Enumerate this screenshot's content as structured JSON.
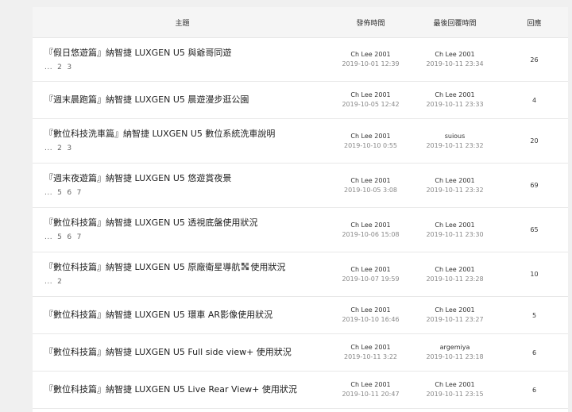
{
  "header": {
    "topic": "主題",
    "published": "發佈時間",
    "last_reply": "最後回覆時間",
    "replies": "回應"
  },
  "rows": [
    {
      "title": "『假日悠遊篇』納智捷 LUXGEN U5 與爺哥同遊",
      "pages": [
        "...",
        "2",
        "3"
      ],
      "pub_user": "Ch Lee 2001",
      "pub_time": "2019-10-01 12:39",
      "last_user": "Ch Lee 2001",
      "last_time": "2019-10-11 23:34",
      "replies": "26"
    },
    {
      "title": "『週末晨跑篇』納智捷 LUXGEN U5 晨遊漫步逛公園",
      "pages": [],
      "pub_user": "Ch Lee 2001",
      "pub_time": "2019-10-05 12:42",
      "last_user": "Ch Lee 2001",
      "last_time": "2019-10-11 23:33",
      "replies": "4"
    },
    {
      "title": "『數位科技洗車篇』納智捷 LUXGEN U5 數位系統洗車說明",
      "pages": [
        "...",
        "2",
        "3"
      ],
      "pub_user": "Ch Lee 2001",
      "pub_time": "2019-10-10 0:55",
      "last_user": "suious",
      "last_time": "2019-10-11 23:32",
      "replies": "20"
    },
    {
      "title": "『週末夜遊篇』納智捷 LUXGEN U5 悠遊賞夜景",
      "pages": [
        "...",
        "5",
        "6",
        "7"
      ],
      "pub_user": "Ch Lee 2001",
      "pub_time": "2019-10-05 3:08",
      "last_user": "Ch Lee 2001",
      "last_time": "2019-10-11 23:32",
      "replies": "69"
    },
    {
      "title": "『數位科技篇』納智捷 LUXGEN U5 透視底盤使用狀況",
      "pages": [
        "...",
        "5",
        "6",
        "7"
      ],
      "pub_user": "Ch Lee 2001",
      "pub_time": "2019-10-06 15:08",
      "last_user": "Ch Lee 2001",
      "last_time": "2019-10-11 23:30",
      "replies": "65"
    },
    {
      "title": "『數位科技篇』納智捷 LUXGEN U5 原廠衛星導航",
      "title_suffix": "使用狀況",
      "has_emoji": true,
      "pages": [
        "...",
        "2"
      ],
      "pub_user": "Ch Lee 2001",
      "pub_time": "2019-10-07 19:59",
      "last_user": "Ch Lee 2001",
      "last_time": "2019-10-11 23:28",
      "replies": "10"
    },
    {
      "title": "『數位科技篇』納智捷 LUXGEN U5 環車 AR影像使用狀況",
      "pages": [],
      "pub_user": "Ch Lee 2001",
      "pub_time": "2019-10-10 16:46",
      "last_user": "Ch Lee 2001",
      "last_time": "2019-10-11 23:27",
      "replies": "5"
    },
    {
      "title": "『數位科技篇』納智捷 LUXGEN U5 Full side view+ 使用狀況",
      "pages": [],
      "pub_user": "Ch Lee 2001",
      "pub_time": "2019-10-11 3:22",
      "last_user": "argemiya",
      "last_time": "2019-10-11 23:18",
      "replies": "6"
    },
    {
      "title": "『數位科技篇』納智捷 LUXGEN U5 Live Rear View+ 使用狀況",
      "pages": [],
      "pub_user": "Ch Lee 2001",
      "pub_time": "2019-10-11 20:47",
      "last_user": "Ch Lee 2001",
      "last_time": "2019-10-11 23:15",
      "replies": "6"
    }
  ],
  "colors": {
    "background": "#f0f0f0",
    "header_bg": "#f5f5f5",
    "divider": "#e8e8e8"
  }
}
